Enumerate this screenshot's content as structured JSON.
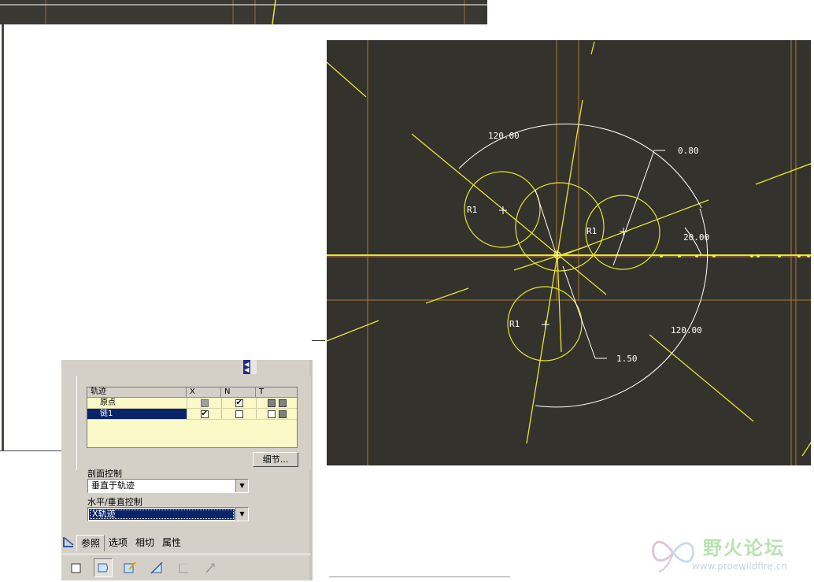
{
  "traj_table": {
    "headers": {
      "name": "轨迹",
      "x": "X",
      "n": "N",
      "t": "T"
    },
    "rows": [
      {
        "name": "原点",
        "x": "disabled",
        "n": "checked",
        "t": "dark/dark"
      },
      {
        "name": "链1",
        "x": "checked",
        "n": "unchecked",
        "t": "empty/dark"
      }
    ]
  },
  "detail_button": "细节...",
  "section_control": {
    "label": "剖面控制",
    "value": "垂直于轨迹"
  },
  "hv_control": {
    "label": "水平/垂直控制",
    "value": "X轨迹"
  },
  "tabs": [
    "参照",
    "选项",
    "相切",
    "属性"
  ],
  "sketch": {
    "dims": [
      "120.00",
      "0.80",
      "20.00",
      "120.00",
      "1.50"
    ],
    "radius_labels": [
      "R1",
      "R1",
      "R1"
    ]
  },
  "colors": {
    "viewport_bg": "#34322c",
    "sketch_yellow": "#e6e62e",
    "datum_orange": "#b07830",
    "selection_blue": "#0a246a"
  },
  "watermark": {
    "title": "野火论坛",
    "url": "www.proewildfire.cn"
  },
  "icons": [
    "back-arrow-icon",
    "solid-icon",
    "surface-icon",
    "sketch-icon",
    "section-icon",
    "thin-icon",
    "arrow-icon"
  ]
}
